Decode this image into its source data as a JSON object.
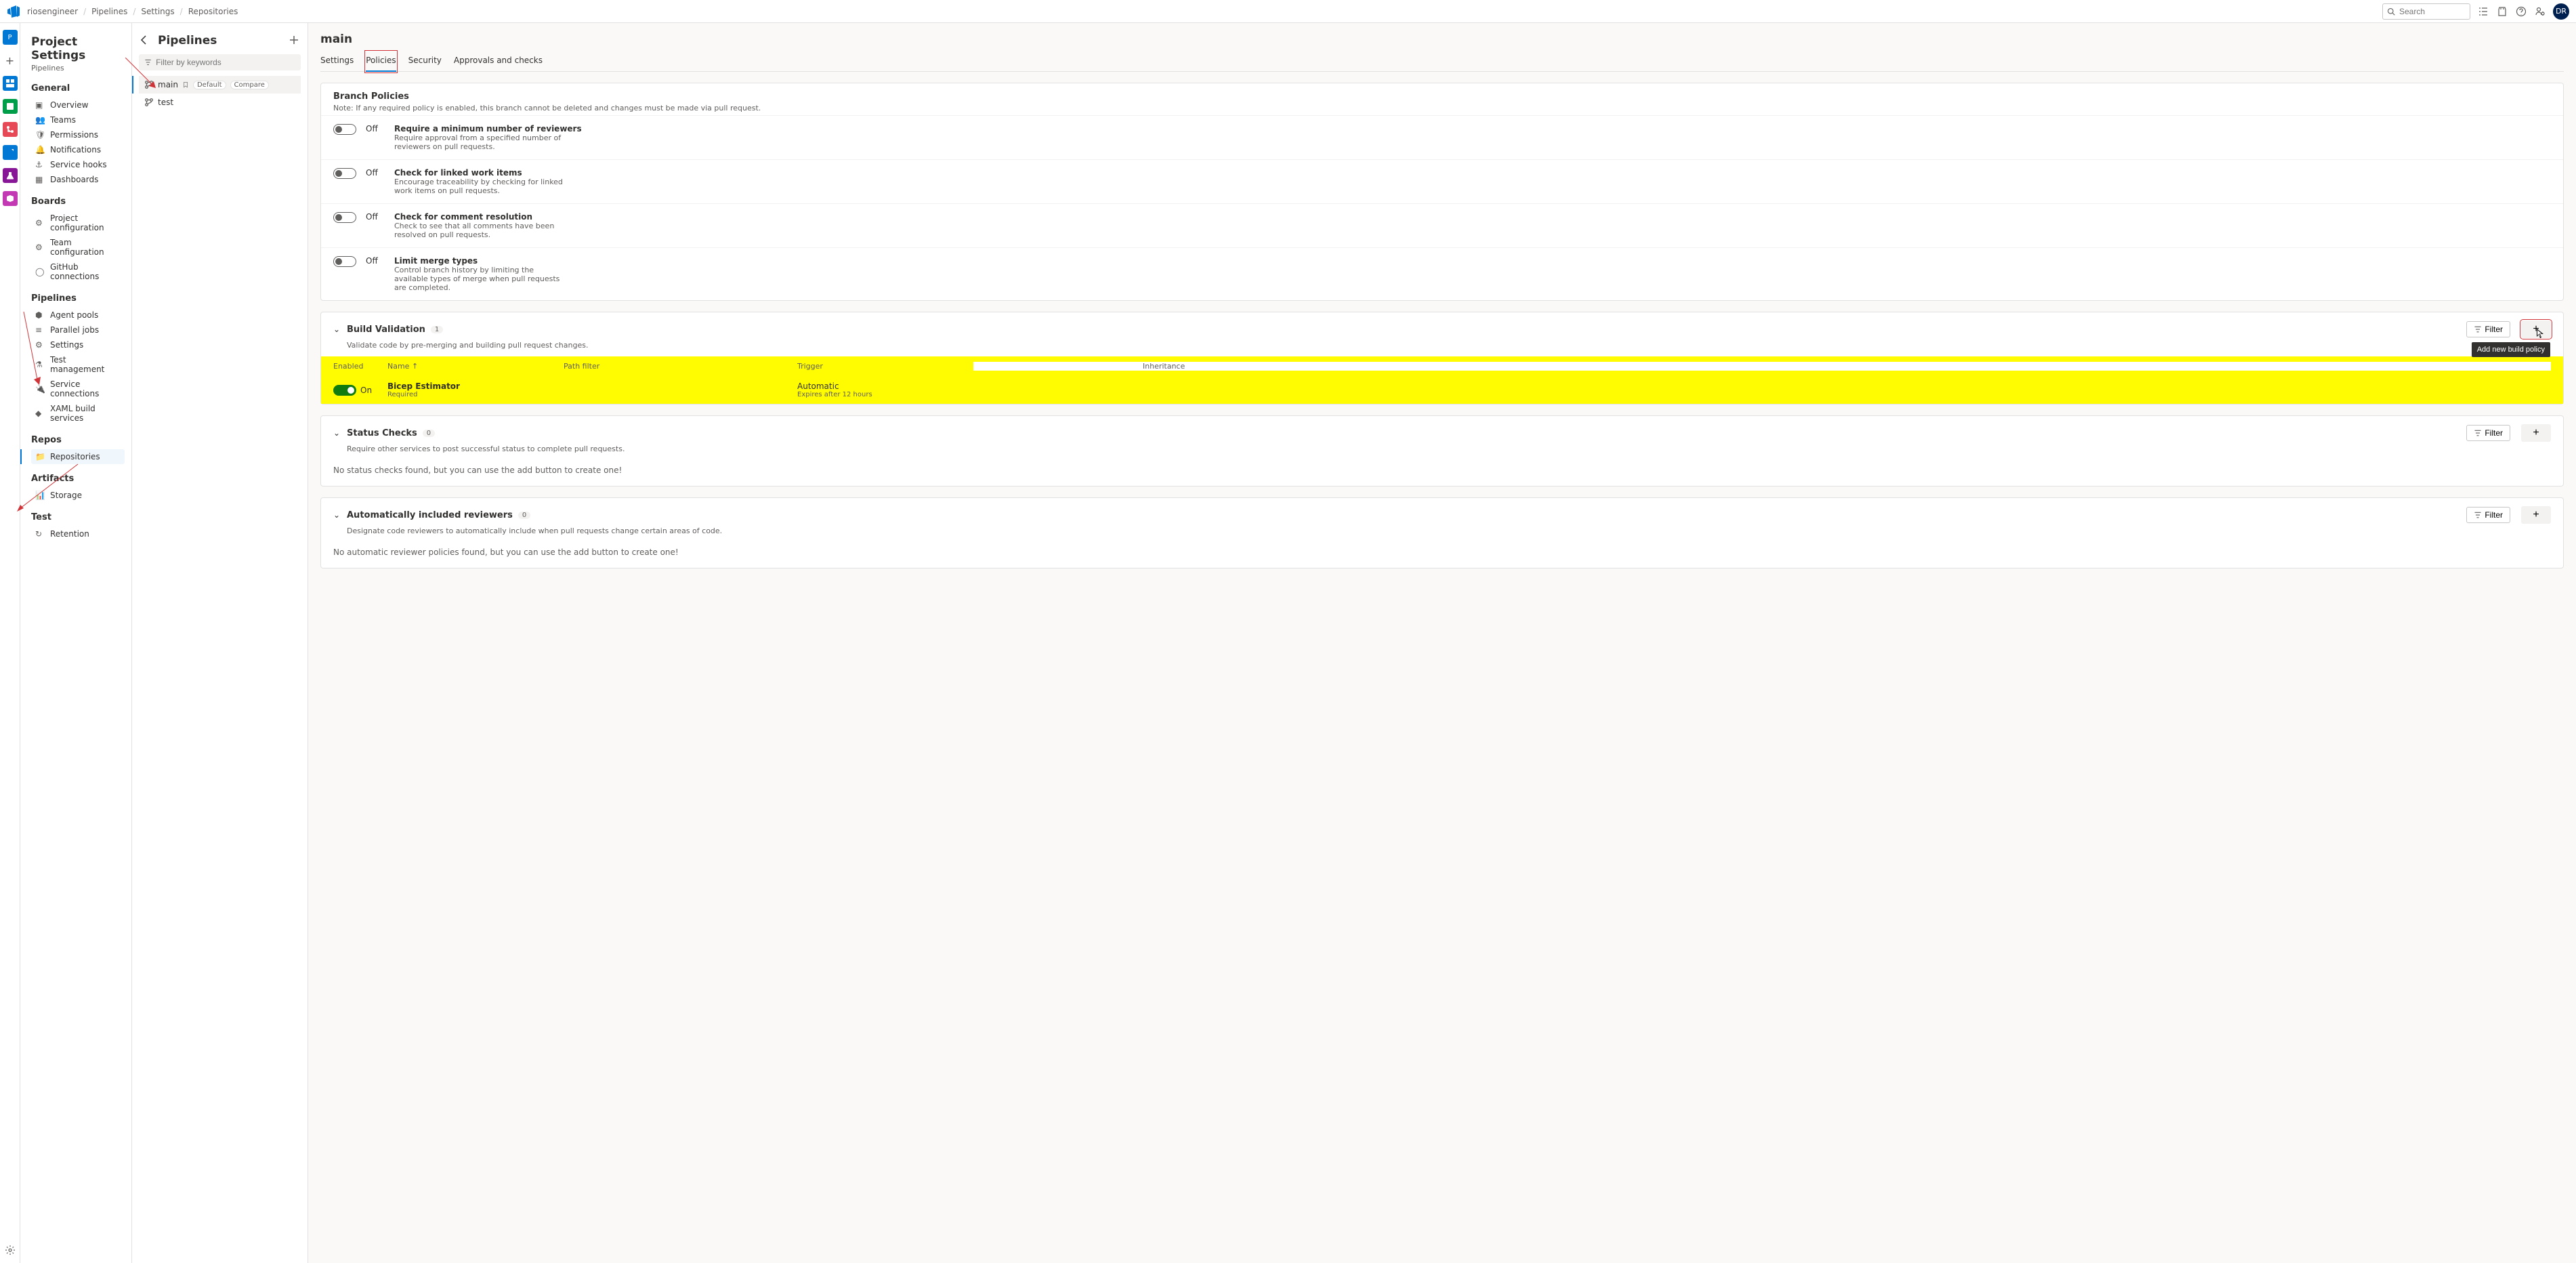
{
  "header": {
    "breadcrumbs": [
      "riosengineer",
      "Pipelines",
      "Settings",
      "Repositories"
    ],
    "search_placeholder": "Search",
    "avatar": "DR"
  },
  "settings_nav": {
    "title": "Project Settings",
    "subtitle": "Pipelines",
    "groups": [
      {
        "title": "General",
        "items": [
          "Overview",
          "Teams",
          "Permissions",
          "Notifications",
          "Service hooks",
          "Dashboards"
        ]
      },
      {
        "title": "Boards",
        "items": [
          "Project configuration",
          "Team configuration",
          "GitHub connections"
        ]
      },
      {
        "title": "Pipelines",
        "items": [
          "Agent pools",
          "Parallel jobs",
          "Settings",
          "Test management",
          "Service connections",
          "XAML build services"
        ]
      },
      {
        "title": "Repos",
        "items": [
          "Repositories"
        ]
      },
      {
        "title": "Artifacts",
        "items": [
          "Storage"
        ]
      },
      {
        "title": "Test",
        "items": [
          "Retention"
        ]
      }
    ]
  },
  "pipelines_panel": {
    "title": "Pipelines",
    "filter_placeholder": "Filter by keywords",
    "branches": [
      {
        "name": "main",
        "default_label": "Default",
        "compare_label": "Compare"
      },
      {
        "name": "test"
      }
    ]
  },
  "main_content": {
    "title": "main",
    "tabs": [
      "Settings",
      "Policies",
      "Security",
      "Approvals and checks"
    ],
    "branch_policies": {
      "heading": "Branch Policies",
      "note": "Note: If any required policy is enabled, this branch cannot be deleted and changes must be made via pull request.",
      "rows": [
        {
          "state": "Off",
          "title": "Require a minimum number of reviewers",
          "desc": "Require approval from a specified number of reviewers on pull requests."
        },
        {
          "state": "Off",
          "title": "Check for linked work items",
          "desc": "Encourage traceability by checking for linked work items on pull requests."
        },
        {
          "state": "Off",
          "title": "Check for comment resolution",
          "desc": "Check to see that all comments have been resolved on pull requests."
        },
        {
          "state": "Off",
          "title": "Limit merge types",
          "desc": "Control branch history by limiting the available types of merge when pull requests are completed."
        }
      ]
    },
    "build_validation": {
      "heading": "Build Validation",
      "count": "1",
      "desc": "Validate code by pre-merging and building pull request changes.",
      "cols": {
        "enabled": "Enabled",
        "name": "Name ↑",
        "path": "Path filter",
        "trigger": "Trigger",
        "inh": "Inheritance"
      },
      "rows": [
        {
          "state": "On",
          "name": "Bicep Estimator",
          "req": "Required",
          "trigger": "Automatic",
          "expires": "Expires after 12 hours"
        }
      ],
      "filter_label": "Filter",
      "tooltip": "Add new build policy"
    },
    "status_checks": {
      "heading": "Status Checks",
      "count": "0",
      "desc": "Require other services to post successful status to complete pull requests.",
      "empty": "No status checks found, but you can use the add button to create one!",
      "filter_label": "Filter"
    },
    "auto_reviewers": {
      "heading": "Automatically included reviewers",
      "count": "0",
      "desc": "Designate code reviewers to automatically include when pull requests change certain areas of code.",
      "empty": "No automatic reviewer policies found, but you can use the add button to create one!",
      "filter_label": "Filter"
    }
  }
}
